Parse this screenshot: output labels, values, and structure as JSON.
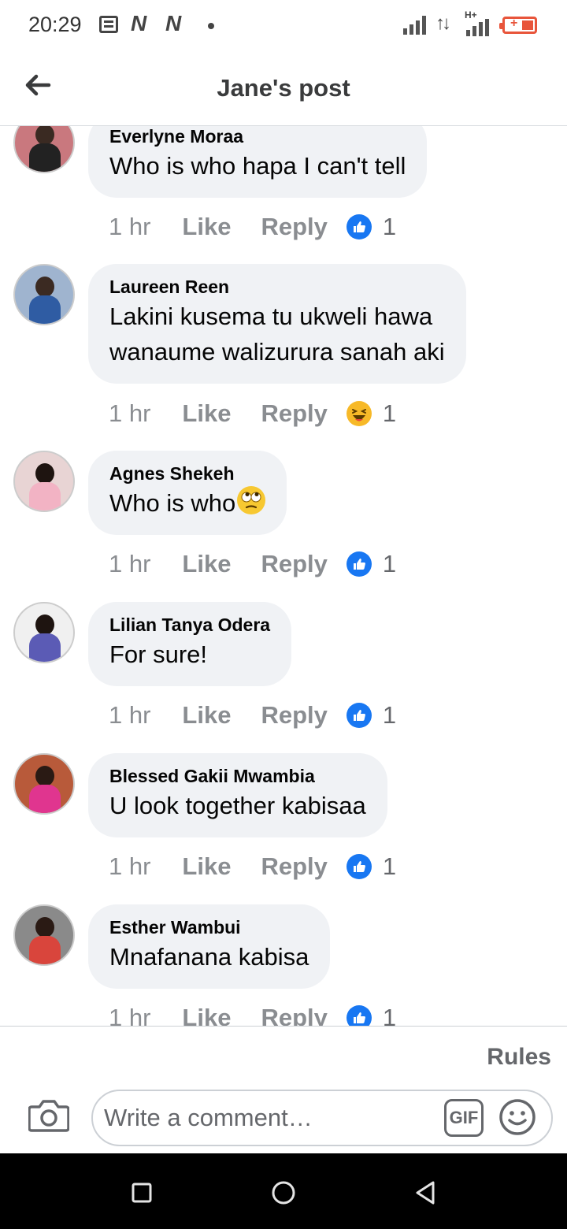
{
  "status_bar": {
    "time": "20:29",
    "notif_n1": "N",
    "notif_n2": "N",
    "network_type": "H+"
  },
  "header": {
    "title": "Jane's post",
    "back_icon": "arrow-left-icon"
  },
  "comments": [
    {
      "author": "Everlyne Moraa",
      "text": "Who is who hapa I can't tell",
      "time": "1 hr",
      "like_label": "Like",
      "reply_label": "Reply",
      "reaction": "like",
      "reaction_count": "1",
      "avatar_color": "#c9787e"
    },
    {
      "author": "Laureen Reen",
      "text_line1": "Lakini kusema tu ukweli hawa",
      "text_line2": "wanaume walizurura sanah aki",
      "time": "1 hr",
      "like_label": "Like",
      "reply_label": "Reply",
      "reaction": "laugh",
      "reaction_count": "1",
      "avatar_color": "#4a6fa8"
    },
    {
      "author": "Agnes Shekeh",
      "text": "Who is who",
      "text_emoji": "face-with-rolling-eyes",
      "time": "1 hr",
      "like_label": "Like",
      "reply_label": "Reply",
      "reaction": "like",
      "reaction_count": "1",
      "avatar_color": "#e6c3c9"
    },
    {
      "author": "Lilian Tanya Odera",
      "text": "For sure!",
      "time": "1 hr",
      "like_label": "Like",
      "reply_label": "Reply",
      "reaction": "like",
      "reaction_count": "1",
      "avatar_color": "#5b5bb5"
    },
    {
      "author": "Blessed Gakii Mwambia",
      "text": "U look together kabisaa",
      "time": "1 hr",
      "like_label": "Like",
      "reply_label": "Reply",
      "reaction": "like",
      "reaction_count": "1",
      "avatar_color": "#d63c8c"
    },
    {
      "author": "Esther Wambui",
      "text": "Mnafanana kabisa",
      "time": "1 hr",
      "like_label": "Like",
      "reply_label": "Reply",
      "reaction": "like",
      "reaction_count": "1",
      "avatar_color": "#d9453c"
    }
  ],
  "footer": {
    "rules_label": "Rules",
    "comment_placeholder": "Write a comment…",
    "gif_label": "GIF"
  },
  "colors": {
    "like_blue": "#1877f2",
    "bubble_gray": "#f0f2f5",
    "muted_text": "#8a8d91"
  }
}
